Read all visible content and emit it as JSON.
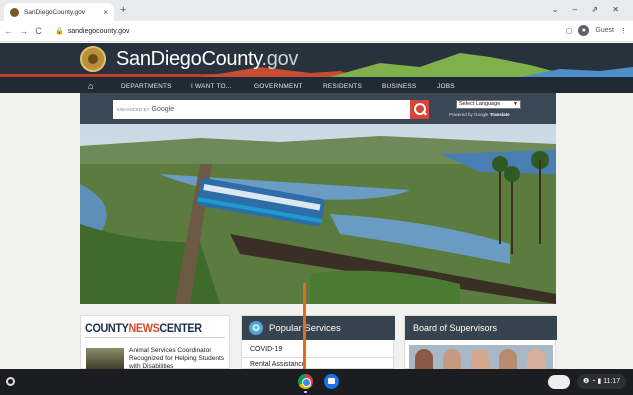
{
  "browser": {
    "tab_title": "SanDiegoCounty.gov",
    "tab_close": "×",
    "new_tab": "+",
    "window_controls": "⌄ – ⇗ ✕",
    "back": "←",
    "forward": "→",
    "reload": "C",
    "lock": "🔒",
    "url": "sandiegocounty.gov",
    "tab_search_icon": "▢",
    "profile_label": "Guest",
    "menu_icon": "⋮"
  },
  "site": {
    "name_main": "SanDiegoCounty",
    "name_suffix": ".gov",
    "nav": [
      "DEPARTMENTS",
      "I WANT TO...",
      "GOVERNMENT",
      "RESIDENTS",
      "BUSINESS",
      "JOBS"
    ],
    "home_icon": "⌂"
  },
  "search": {
    "enhanced_by": "ENHANCED BY",
    "google": "Google",
    "language_select": "Select Language",
    "powered_by": "Powered by",
    "google_small": "Google",
    "translate": "Translate"
  },
  "news": {
    "head_county": "COUNTY",
    "head_news": "NEWS",
    "head_center": "CENTER",
    "article": "Animal Services Coordinator Recognized for Helping Students with Disabilities"
  },
  "popular": {
    "title": "Popular Services",
    "icon": "✪",
    "items": [
      "COVID-19",
      "Rental Assistance"
    ]
  },
  "board": {
    "title": "Board of Supervisors"
  },
  "shelf": {
    "tray": "❷ ◔ ▮ 11:17"
  },
  "colors": {
    "header_bg": "#27323c",
    "search_btn": "#d9443a",
    "news_accent": "#d24b2a",
    "cursor_line": "#e46b1a"
  }
}
